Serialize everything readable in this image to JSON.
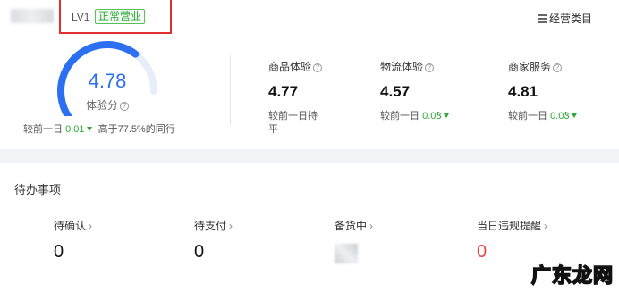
{
  "shop": {
    "level": "LV1",
    "status": "正常营业",
    "category_link": "经营类目"
  },
  "experience_score": {
    "value": "4.78",
    "label": "体验分",
    "gauge_fraction": 0.78,
    "compare_prefix": "较前一日",
    "compare_delta": "0.01",
    "peer_text": "高于77.5%的同行",
    "colors": {
      "gauge": "#2c6ff0",
      "gauge_track": "#e8eef9"
    }
  },
  "metrics": [
    {
      "title": "商品体验",
      "value": "4.77",
      "compare": "较前一日持平",
      "delta": "",
      "trend": "flat"
    },
    {
      "title": "物流体验",
      "value": "4.57",
      "compare": "较前一日",
      "delta": "0.03",
      "trend": "down"
    },
    {
      "title": "商家服务",
      "value": "4.81",
      "compare": "较前一日",
      "delta": "0.03",
      "trend": "down"
    }
  ],
  "todo": {
    "title": "待办事项",
    "items": [
      {
        "label": "待确认",
        "value": "0"
      },
      {
        "label": "待支付",
        "value": "0"
      },
      {
        "label": "备货中",
        "value": ""
      },
      {
        "label": "当日违规提醒",
        "value": "0"
      }
    ]
  },
  "watermark": {
    "text": "广东龙网"
  },
  "colors": {
    "accent": "#2c6ff0",
    "up_down_green": "#2ea739",
    "alert_red": "#e54545",
    "frame_red": "#e03030"
  }
}
